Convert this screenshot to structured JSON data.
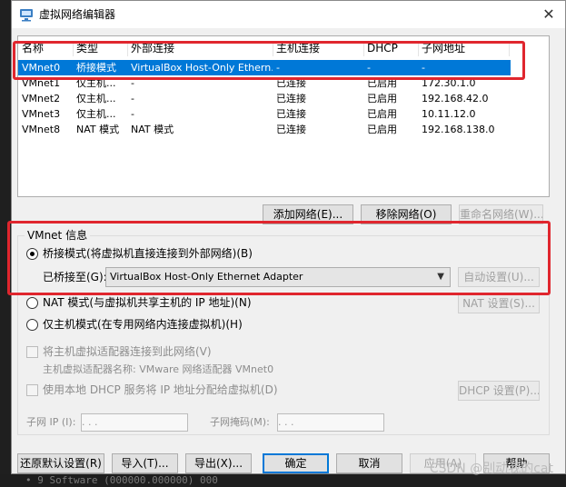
{
  "window": {
    "title": "虚拟网络编辑器",
    "close_glyph": "✕"
  },
  "table": {
    "headers": [
      "名称",
      "类型",
      "外部连接",
      "主机连接",
      "DHCP",
      "子网地址"
    ],
    "rows": [
      [
        "VMnet0",
        "桥接模式",
        "VirtualBox Host-Only Ethern...",
        "-",
        "-",
        "-"
      ],
      [
        "VMnet1",
        "仅主机...",
        "-",
        "已连接",
        "已启用",
        "172.30.1.0"
      ],
      [
        "VMnet2",
        "仅主机...",
        "-",
        "已连接",
        "已启用",
        "192.168.42.0"
      ],
      [
        "VMnet3",
        "仅主机...",
        "-",
        "已连接",
        "已启用",
        "10.11.12.0"
      ],
      [
        "VMnet8",
        "NAT 模式",
        "NAT 模式",
        "已连接",
        "已启用",
        "192.168.138.0"
      ]
    ],
    "selected_row": 0
  },
  "list_buttons": {
    "add": "添加网络(E)...",
    "remove": "移除网络(O)",
    "rename": "重命名网络(W)..."
  },
  "vmnet_info": {
    "group_label": "VMnet 信息",
    "bridged": "桥接模式(将虚拟机直接连接到外部网络)(B)",
    "bridged_to_label": "已桥接至(G):",
    "bridged_to_value": "VirtualBox Host-Only Ethernet Adapter",
    "auto_settings": "自动设置(U)...",
    "nat": "NAT 模式(与虚拟机共享主机的 IP 地址)(N)",
    "nat_settings": "NAT 设置(S)...",
    "hostonly": "仅主机模式(在专用网络内连接虚拟机)(H)",
    "connect_adapter": "将主机虚拟适配器连接到此网络(V)",
    "adapter_name": "主机虚拟适配器名称: VMware 网络适配器 VMnet0",
    "use_dhcp": "使用本地 DHCP 服务将 IP 地址分配给虚拟机(D)",
    "dhcp_settings": "DHCP 设置(P)...",
    "subnet_ip_label": "子网 IP (I):",
    "subnet_mask_label": "子网掩码(M):",
    "ip_placeholder": "  .   .   .  "
  },
  "footer": {
    "restore": "还原默认设置(R)",
    "import": "导入(T)...",
    "export": "导出(X)...",
    "ok": "确定",
    "cancel": "取消",
    "apply": "应用(A)",
    "help": "帮助"
  },
  "watermark": "CSDN @别动我的cat",
  "background_text": "• 9 Software (000000.000000) 000"
}
